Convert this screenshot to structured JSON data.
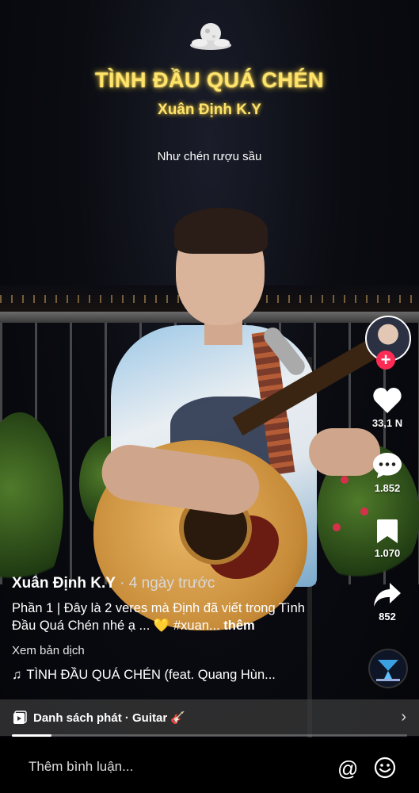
{
  "overlay": {
    "song_title": "TÌNH ĐẦU QUÁ CHÉN",
    "song_artist": "Xuân Định K.Y",
    "lyric": "Như chén rượu sầu"
  },
  "actions": {
    "likes": "33,1 N",
    "comments": "1.852",
    "saves": "1.070",
    "shares": "852"
  },
  "post": {
    "author": "Xuân Định K.Y",
    "posted": " · 4 ngày trước",
    "caption": "Phần 1 | Đây là 2 veres mà Định đã viết trong Tình Đầu Quá Chén nhé ạ ... 💛 #xuan...",
    "more": "thêm",
    "translate": "Xem bản dịch",
    "sound": "TÌNH ĐẦU QUÁ CHÉN (feat. Quang Hùn..."
  },
  "playlist": {
    "label": "Danh sách phát · Guitar 🎸"
  },
  "playback": {
    "progress": 0.1
  },
  "comment_bar": {
    "placeholder": "Thêm bình luận..."
  },
  "colors": {
    "title_glow": "#ffe36b",
    "follow": "#fe2c55",
    "background": "#000000"
  },
  "icons": [
    "moon-logo-icon",
    "heart-icon",
    "comment-icon",
    "bookmark-icon",
    "share-icon",
    "music-note-icon",
    "playlist-icon",
    "chevron-right-icon",
    "at-icon",
    "emoji-icon"
  ]
}
